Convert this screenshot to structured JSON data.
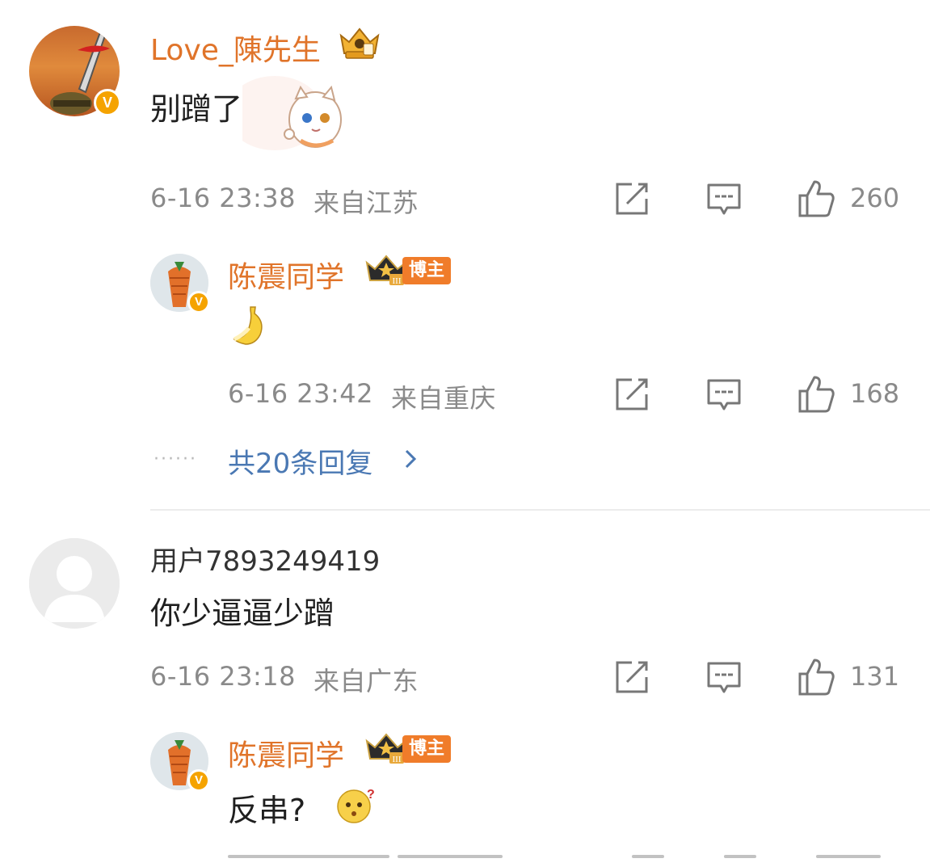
{
  "comments": [
    {
      "username": "Love_陳先生",
      "text": "别蹭了",
      "time": "6-16 23:38",
      "location": "来自江苏",
      "likes": "260",
      "reply": {
        "username": "陈震同学",
        "role_badge": "博主",
        "time": "6-16 23:42",
        "location": "来自重庆",
        "likes": "168"
      },
      "more_replies": "共20条回复"
    },
    {
      "username": "用户7893249419",
      "text": "你少逼逼少蹭",
      "time": "6-16 23:18",
      "location": "来自广东",
      "likes": "131",
      "reply": {
        "username": "陈震同学",
        "role_badge": "博主",
        "text": "反串?"
      }
    }
  ],
  "icons": {
    "share": "share-icon",
    "comment": "comment-icon",
    "like": "thumbs-up-icon",
    "verified": "verified-v-icon",
    "crown": "crown-badge-icon"
  },
  "colors": {
    "username_orange": "#e0742a",
    "link_blue": "#4a78b3",
    "meta_gray": "#8a8a8a",
    "badge_orange": "#f07c2a",
    "verified_gold": "#f5a300"
  }
}
